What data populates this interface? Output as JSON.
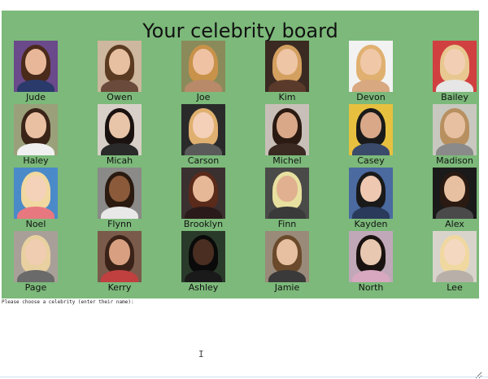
{
  "board": {
    "title": "Your celebrity board",
    "background_color": "#7cb97a",
    "celebrities": [
      {
        "name": "Jude",
        "bg": "#6a4a8a",
        "hair": "#4a2a1a",
        "skin": "#e8b79a",
        "shirt": "#2a3a6a"
      },
      {
        "name": "Owen",
        "bg": "#cdb79e",
        "hair": "#5a3a20",
        "skin": "#e6c0a0",
        "shirt": "#6a4a3a"
      },
      {
        "name": "Joe",
        "bg": "#8a8a5a",
        "hair": "#c8924a",
        "skin": "#efc2a4",
        "shirt": "#b88a6a"
      },
      {
        "name": "Kim",
        "bg": "#3a2a22",
        "hair": "#d4a060",
        "skin": "#eec6a6",
        "shirt": "#5a3a2a"
      },
      {
        "name": "Devon",
        "bg": "#f2f2f2",
        "hair": "#e0b070",
        "skin": "#f0c8a8",
        "shirt": "#d8a880"
      },
      {
        "name": "Bailey",
        "bg": "#d04040",
        "hair": "#e8c890",
        "skin": "#f2cfb4",
        "shirt": "#e6e6e6"
      },
      {
        "name": "Haley",
        "bg": "#9aa07a",
        "hair": "#3a2418",
        "skin": "#eac0a2",
        "shirt": "#f0f0f0"
      },
      {
        "name": "Micah",
        "bg": "#d8d0c8",
        "hair": "#1a1210",
        "skin": "#e8c4a8",
        "shirt": "#2a2a2a"
      },
      {
        "name": "Carson",
        "bg": "#2a2a2a",
        "hair": "#e0b070",
        "skin": "#f4d0b8",
        "shirt": "#5a5a5a"
      },
      {
        "name": "Michel",
        "bg": "#c8c0b8",
        "hair": "#2a1a12",
        "skin": "#d8a888",
        "shirt": "#3a2a22"
      },
      {
        "name": "Casey",
        "bg": "#e8c040",
        "hair": "#1a1a1a",
        "skin": "#d8a888",
        "shirt": "#3a4a6a"
      },
      {
        "name": "Madison",
        "bg": "#c8c8c0",
        "hair": "#b89060",
        "skin": "#e6c0a0",
        "shirt": "#8a8a8a"
      },
      {
        "name": "Noel",
        "bg": "#4a8ac8",
        "hair": "#f0d8a0",
        "skin": "#f4d2ba",
        "shirt": "#e87880"
      },
      {
        "name": "Flynn",
        "bg": "#8a8a88",
        "hair": "#2a1a10",
        "skin": "#8a5a3a",
        "shirt": "#e8e8e8"
      },
      {
        "name": "Brooklyn",
        "bg": "#3a3030",
        "hair": "#5a2a1a",
        "skin": "#e6b898",
        "shirt": "#2a1a1a"
      },
      {
        "name": "Finn",
        "bg": "#4a4a48",
        "hair": "#e8e0a0",
        "skin": "#e0b090",
        "shirt": "#3a3a3a"
      },
      {
        "name": "Kayden",
        "bg": "#4a6aa0",
        "hair": "#1a1a1a",
        "skin": "#eec8b0",
        "shirt": "#2a3a5a"
      },
      {
        "name": "Alex",
        "bg": "#1a1a1a",
        "hair": "#2a1a12",
        "skin": "#e6c0a0",
        "shirt": "#4a4a4a"
      },
      {
        "name": "Page",
        "bg": "#a8a098",
        "hair": "#e8d0a0",
        "skin": "#f0ccb0",
        "shirt": "#6a6a6a"
      },
      {
        "name": "Kerry",
        "bg": "#7a5a4a",
        "hair": "#3a2218",
        "skin": "#d8a080",
        "shirt": "#c04040"
      },
      {
        "name": "Ashley",
        "bg": "#2a3a2a",
        "hair": "#0a0a0a",
        "skin": "#4a2e22",
        "shirt": "#1a1a1a"
      },
      {
        "name": "Jamie",
        "bg": "#9a8a7a",
        "hair": "#6a4a2a",
        "skin": "#e6c0a0",
        "shirt": "#3a3a3a"
      },
      {
        "name": "North",
        "bg": "#c0a8b8",
        "hair": "#1a1210",
        "skin": "#e8c8b0",
        "shirt": "#d8a8c0"
      },
      {
        "name": "Lee",
        "bg": "#d8d4cc",
        "hair": "#f0d8a0",
        "skin": "#f4d8c0",
        "shirt": "#b8b0a8"
      }
    ]
  },
  "prompt": {
    "text": "Please choose a celebrity (enter their name):",
    "value": ""
  },
  "cursor": {
    "glyph": "I"
  }
}
